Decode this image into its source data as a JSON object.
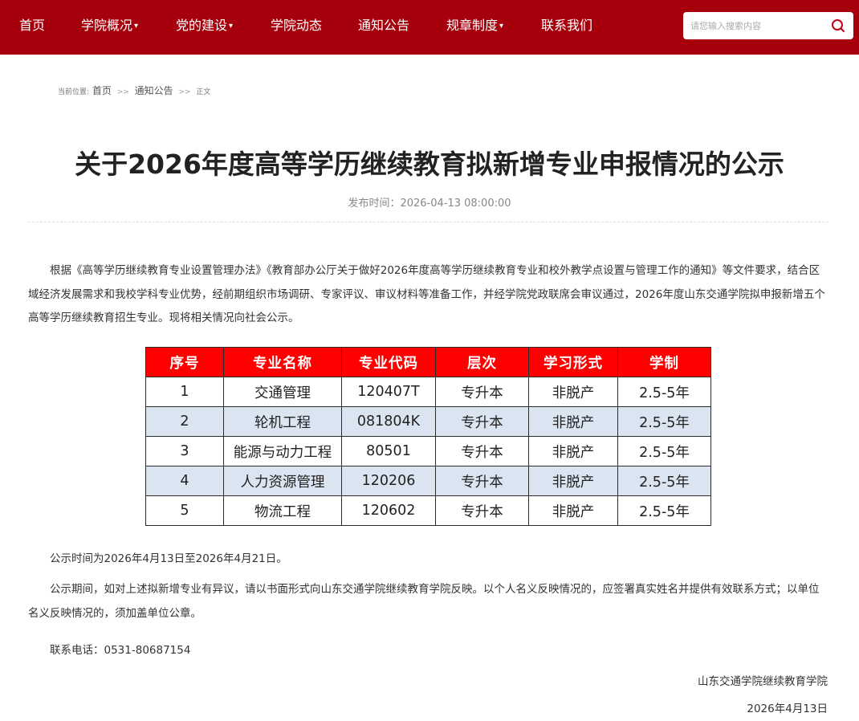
{
  "nav": {
    "items": [
      {
        "label": "首页",
        "dropdown": false
      },
      {
        "label": "学院概况",
        "dropdown": true
      },
      {
        "label": "党的建设",
        "dropdown": true
      },
      {
        "label": "学院动态",
        "dropdown": false
      },
      {
        "label": "通知公告",
        "dropdown": false
      },
      {
        "label": "规章制度",
        "dropdown": true
      },
      {
        "label": "联系我们",
        "dropdown": false
      }
    ],
    "search_placeholder": "请您输入搜索内容",
    "colors": {
      "bar": "#a6000d",
      "search_icon": "#c0001a"
    }
  },
  "breadcrumb": {
    "prefix": "当前位置:",
    "home": "首页",
    "sep": ">>",
    "section": "通知公告",
    "current": "正文"
  },
  "article": {
    "title": "关于2026年度高等学历继续教育拟新增专业申报情况的公示",
    "published": "发布时间：2026-04-13 08:00:00",
    "intro": "根据《高等学历继续教育专业设置管理办法》《教育部办公厅关于做好2026年度高等学历继续教育专业和校外教学点设置与管理工作的通知》等文件要求，结合区域经济发展需求和我校学科专业优势，经前期组织市场调研、专家评议、审议材料等准备工作，并经学院党政联席会审议通过，2026年度山东交通学院拟申报新增五个高等学历继续教育招生专业。现将相关情况向社会公示。",
    "period": "公示时间为2026年4月13日至2026年4月21日。",
    "objection": "公示期间，如对上述拟新增专业有异议，请以书面形式向山东交通学院继续教育学院反映。以个人名义反映情况的，应签署真实姓名并提供有效联系方式；以单位名义反映情况的，须加盖单位公章。",
    "phone": "联系电话：0531-80687154",
    "signature": "山东交通学院继续教育学院",
    "date": "2026年4月13日"
  },
  "table": {
    "headers": [
      "序号",
      "专业名称",
      "专业代码",
      "层次",
      "学习形式",
      "学制"
    ],
    "rows": [
      [
        "1",
        "交通管理",
        "120407T",
        "专升本",
        "非脱产",
        "2.5-5年"
      ],
      [
        "2",
        "轮机工程",
        "081804K",
        "专升本",
        "非脱产",
        "2.5-5年"
      ],
      [
        "3",
        "能源与动力工程",
        "80501",
        "专升本",
        "非脱产",
        "2.5-5年"
      ],
      [
        "4",
        "人力资源管理",
        "120206",
        "专升本",
        "非脱产",
        "2.5-5年"
      ],
      [
        "5",
        "物流工程",
        "120602",
        "专升本",
        "非脱产",
        "2.5-5年"
      ]
    ],
    "colors": {
      "header_bg": "#ff0000",
      "alt_row_bg": "#dbe4f1"
    }
  }
}
